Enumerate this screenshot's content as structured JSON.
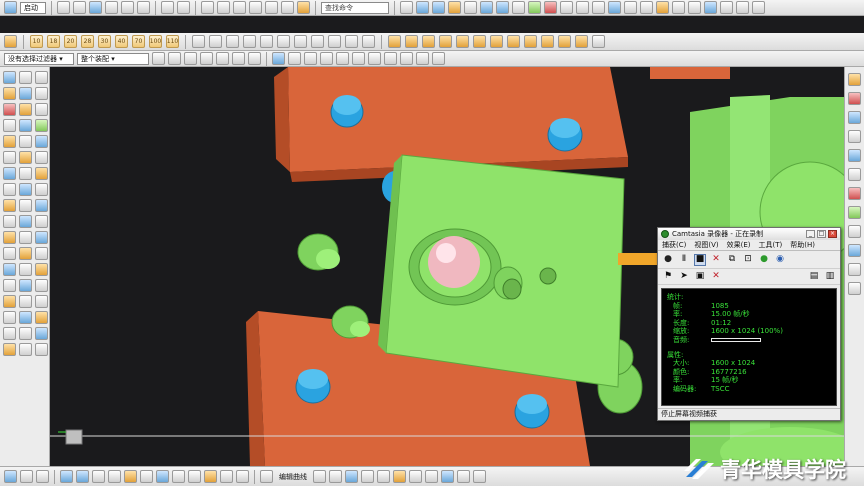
{
  "toolbar_top": {
    "start_label": "启动",
    "find_command_placeholder": "查找命令"
  },
  "toolbar_second": {
    "numbers": [
      "10",
      "18",
      "20",
      "28",
      "30",
      "40",
      "70",
      "100",
      "110"
    ]
  },
  "filter_bar": {
    "selection_filter": "没有选择过滤器",
    "scope": "整个装配"
  },
  "camtasia": {
    "title": "Camtasia 录像器 - 正在录制",
    "menu": [
      "捕获(C)",
      "视图(V)",
      "效果(E)",
      "工具(T)",
      "帮助(H)"
    ],
    "stats_header": "统计:",
    "stats": [
      {
        "k": "帧:",
        "v": "1085"
      },
      {
        "k": "率:",
        "v": "15.00 帧/秒"
      },
      {
        "k": "长度:",
        "v": "01:12"
      },
      {
        "k": "缩放:",
        "v": "1600 x 1024 (100%)"
      },
      {
        "k": "音频:",
        "v": ""
      }
    ],
    "props_header": "属性:",
    "props": [
      {
        "k": "大小:",
        "v": "1600 x 1024"
      },
      {
        "k": "颜色:",
        "v": "16777216"
      },
      {
        "k": "率:",
        "v": "15 帧/秒"
      },
      {
        "k": "编码器:",
        "v": "TSCC"
      }
    ],
    "status": "停止屏幕视频捕获"
  },
  "bottom_bar": {
    "edit_curve": "编辑曲线"
  },
  "watermark": {
    "text": "青华模具学院"
  },
  "colors": {
    "plate_orange": "#d9653a",
    "plate_green": "#8fe36a",
    "bolt_blue": "#2aa3e0",
    "ball_pink": "#f0b8c0",
    "background": "#1a1a1c"
  }
}
